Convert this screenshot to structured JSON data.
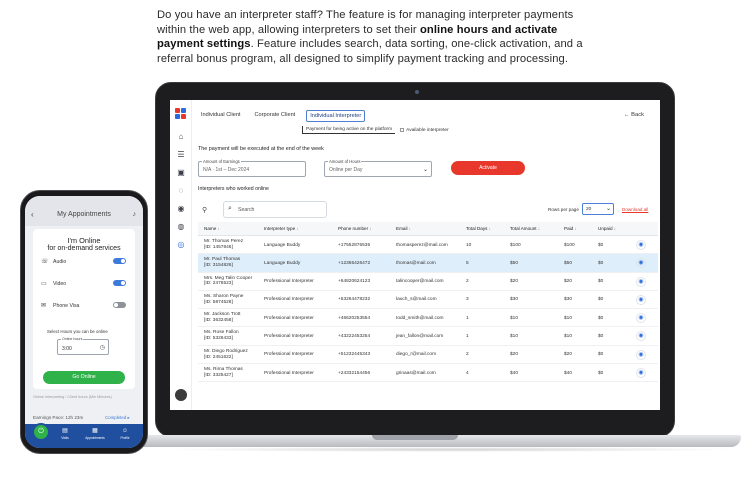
{
  "intro": {
    "part1": "Do you have an interpreter staff? The feature is for managing interpreter payments within the web app, allowing interpreters to set their ",
    "bold1": "online hours and activate payment settings",
    "part2": ". Feature includes search, data sorting, one-click activation, and a referral bonus program, all designed to simplify payment tracking and processing."
  },
  "app": {
    "tabs": [
      "Individual Client",
      "Corporate Client",
      "Individual Interpreter"
    ],
    "active_tab": 2,
    "back_label": "← Back",
    "subbar": {
      "left": "Payment for being active on the platform",
      "right": "Available interpreter"
    },
    "payment_note": "The payment will be executed at the end of the week",
    "amount_field": {
      "label": "Amount of Earnings",
      "value": "N/A  ·  1st  –  Dec 2024"
    },
    "hours_field": {
      "label": "Amount of Hours",
      "value": "Online per Day"
    },
    "activate_label": "Activate",
    "list_title": "Interpreters who worked online",
    "search_placeholder": "Search",
    "rows_per_page_label": "Rows per page",
    "rows_per_page_value": "20",
    "download_label": "Download all",
    "columns": [
      "Name",
      "Interpreter type",
      "Phone number",
      "Email",
      "Total Days",
      "Total Amount",
      "Paid",
      "Unpaid"
    ],
    "rows": [
      {
        "name": "Mr. Thomas Perez",
        "id": "[ID: 1457846]",
        "type": "Language Buddy",
        "phone": "+17552876535",
        "email": "thomasperez@mail.com",
        "days": "10",
        "amount": "$100",
        "paid": "$100",
        "unpaid": "$0",
        "selected": false
      },
      {
        "name": "Mr. Paul Thomas",
        "id": "[ID: 3154826]",
        "type": "Language Buddy",
        "phone": "+12365426472",
        "email": "thomas@mail.com",
        "days": "5",
        "amount": "$50",
        "paid": "$50",
        "unpaid": "$0",
        "selected": true
      },
      {
        "name": "Mrs. Meg Talin Cooper",
        "id": "[ID: 2476523]",
        "type": "Professional Interpreter",
        "phone": "+64820624123",
        "email": "talincooper@mail.com",
        "days": "2",
        "amount": "$20",
        "paid": "$20",
        "unpaid": "$0",
        "selected": false
      },
      {
        "name": "Ms. Sharon Payne",
        "id": "[ID: 5874528]",
        "type": "Professional Interpreter",
        "phone": "+53264478232",
        "email": "lauch_s@mail.com",
        "days": "3",
        "amount": "$30",
        "paid": "$30",
        "unpaid": "$0",
        "selected": false
      },
      {
        "name": "Mr. Jackson Trott",
        "id": "[ID: 3632458]",
        "type": "Professional Interpreter",
        "phone": "+46620253554",
        "email": "todd_smith@mail.com",
        "days": "1",
        "amount": "$10",
        "paid": "$10",
        "unpaid": "$0",
        "selected": false
      },
      {
        "name": "Ms. Rose Fallon",
        "id": "[ID: 5326433]",
        "type": "Professional Interpreter",
        "phone": "+43222453254",
        "email": "jean_fallon@mail.com",
        "days": "1",
        "amount": "$10",
        "paid": "$10",
        "unpaid": "$0",
        "selected": false
      },
      {
        "name": "Mr. Diego Rodriguez",
        "id": "[ID: 2451622]",
        "type": "Professional Interpreter",
        "phone": "+51232445343",
        "email": "diego_r@mail.com",
        "days": "2",
        "amount": "$20",
        "paid": "$20",
        "unpaid": "$0",
        "selected": false
      },
      {
        "name": "Ms. Rima Thomas",
        "id": "[ID: 3325427]",
        "type": "Professional Interpreter",
        "phone": "+24332154456",
        "email": "grinaas@mail.com",
        "days": "4",
        "amount": "$40",
        "paid": "$40",
        "unpaid": "$0",
        "selected": false
      }
    ]
  },
  "phone": {
    "title": "My Appointments",
    "online_title": "I'm Online",
    "online_sub": "for on-demand services",
    "options": [
      {
        "label": "Audio",
        "icon": "phone-icon",
        "on": true
      },
      {
        "label": "Video",
        "icon": "video-icon",
        "on": true
      },
      {
        "label": "Phone Visa",
        "icon": "sms-icon",
        "on": false
      }
    ],
    "hours_label": "Select Hours you can be online",
    "hours_field_label": "Online hours",
    "hours_value": "3:00",
    "go_label": "Go Online",
    "footer_note": "Online Interpreting / Client hours (Min Minutes)",
    "footer_left": "Earnings Pace: 12h 23m",
    "footer_right": "Completed ▸",
    "nav": [
      "Online",
      "Visits",
      "Appointments",
      "Profile"
    ]
  },
  "colors": {
    "accent": "#e8372b",
    "primary": "#2c6bd9",
    "success": "#2fb24a",
    "nav": "#1f4f9e"
  }
}
